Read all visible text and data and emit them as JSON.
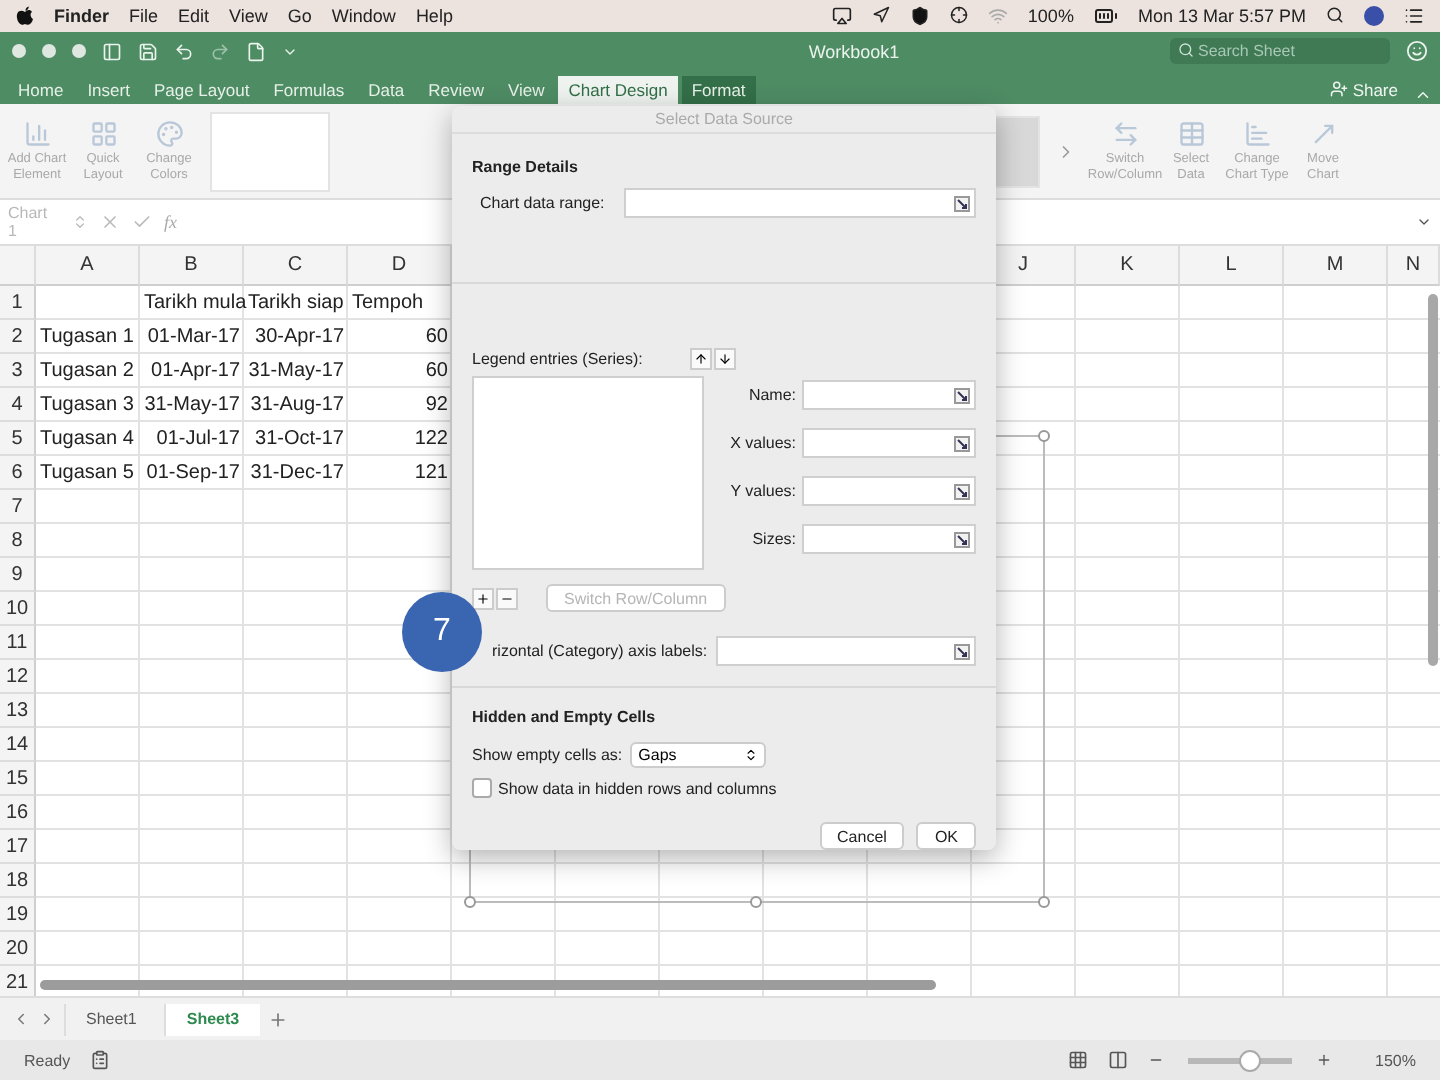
{
  "menu_bar": {
    "app": "Finder",
    "menus": [
      "File",
      "Edit",
      "View",
      "Go",
      "Window",
      "Help"
    ],
    "battery": "100%",
    "clock": "Mon 13 Mar  5:57 PM"
  },
  "title_bar": {
    "title": "Workbook1",
    "search": {
      "placeholder": "Search Sheet"
    }
  },
  "ribbon_tabs": [
    {
      "label": "Home",
      "selected": false,
      "kind": "standard"
    },
    {
      "label": "Insert",
      "selected": false,
      "kind": "standard"
    },
    {
      "label": "Page Layout",
      "selected": false,
      "kind": "standard"
    },
    {
      "label": "Formulas",
      "selected": false,
      "kind": "standard"
    },
    {
      "label": "Data",
      "selected": false,
      "kind": "standard"
    },
    {
      "label": "Review",
      "selected": false,
      "kind": "standard"
    },
    {
      "label": "View",
      "selected": false,
      "kind": "standard"
    },
    {
      "label": "Chart Design",
      "selected": true,
      "kind": "contextual"
    },
    {
      "label": "Format",
      "selected": false,
      "kind": "contextual"
    }
  ],
  "share": "Share",
  "ribbon": {
    "left": [
      {
        "label": "Add Chart Element",
        "disabled": true,
        "kind": "chart"
      },
      {
        "label": "Quick Layout",
        "disabled": true,
        "kind": "layout"
      },
      {
        "label": "Change Colors",
        "disabled": true,
        "kind": "colors"
      }
    ],
    "right": [
      {
        "label": "Switch Row/Column",
        "disabled": true,
        "kind": "switch"
      },
      {
        "label": "Select Data",
        "disabled": true,
        "kind": "data"
      },
      {
        "label": "Change Chart Type",
        "disabled": true,
        "kind": "type"
      },
      {
        "label": "Move Chart",
        "disabled": true,
        "kind": "move"
      }
    ]
  },
  "formula_bar": {
    "name_box": "Chart 1",
    "function_label": "fx"
  },
  "sheet": {
    "columns_left": [
      "A",
      "B",
      "C",
      "D"
    ],
    "columns_right": [
      "J",
      "K",
      "L",
      "M",
      "N"
    ],
    "row_numbers": [
      "1",
      "2",
      "3",
      "4",
      "5",
      "6",
      "7",
      "8",
      "9",
      "10",
      "11",
      "12",
      "13",
      "14",
      "15",
      "16",
      "17",
      "18",
      "19",
      "20",
      "21"
    ],
    "headings": [
      "Tarikh mula",
      "Tarikh siap",
      "Tempoh"
    ],
    "tasks": [
      {
        "name": "Tugasan 1",
        "start": "01-Mar-17",
        "end": "30-Apr-17",
        "duration": "60"
      },
      {
        "name": "Tugasan 2",
        "start": "01-Apr-17",
        "end": "31-May-17",
        "duration": "60"
      },
      {
        "name": "Tugasan 3",
        "start": "31-May-17",
        "end": "31-Aug-17",
        "duration": "92"
      },
      {
        "name": "Tugasan 4",
        "start": "01-Jul-17",
        "end": "31-Oct-17",
        "duration": "122"
      },
      {
        "name": "Tugasan 5",
        "start": "01-Sep-17",
        "end": "31-Dec-17",
        "duration": "121"
      }
    ]
  },
  "dialog": {
    "title": "Select Data Source",
    "range_heading": "Range Details",
    "data_range_label": "Chart data range:",
    "legend_label": "Legend entries (Series):",
    "series_fields": [
      {
        "label": "Name:"
      },
      {
        "label": "X values:"
      },
      {
        "label": "Y values:"
      },
      {
        "label": "Sizes:"
      }
    ],
    "switch_button": {
      "label": "Switch Row/Column",
      "disabled": true
    },
    "axis_label": "rizontal (Category) axis labels:",
    "hidden_heading": "Hidden and Empty Cells",
    "empty_cells_label": "Show empty cells as:",
    "empty_cells_value": "Gaps",
    "hidden_data": {
      "label": "Show data in hidden rows and columns",
      "checked": false
    },
    "buttons": [
      "Cancel",
      "OK"
    ]
  },
  "step_badge": "7",
  "sheet_tabs": [
    {
      "label": "Sheet1",
      "selected": false
    },
    {
      "label": "Sheet3",
      "selected": true
    }
  ],
  "status_bar": {
    "status": "Ready",
    "zoom": {
      "level": 0.6
    },
    "zoom_reading": "150%"
  }
}
